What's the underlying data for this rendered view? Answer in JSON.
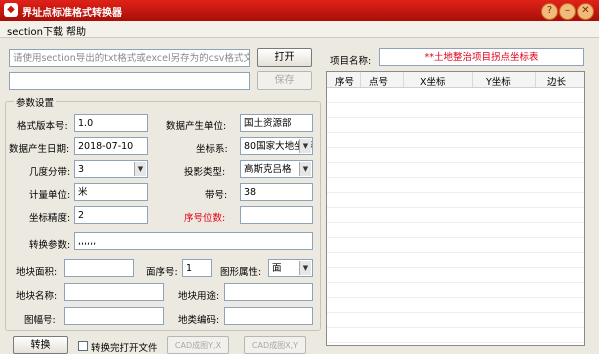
{
  "window": {
    "title": "界址点标准格式转换器",
    "icon_glyph": "◆",
    "buttons": {
      "help": "?",
      "minimize": "–",
      "maximize": "□",
      "close": "✕"
    }
  },
  "menu": {
    "items": [
      "section下载",
      "帮助"
    ]
  },
  "file": {
    "path_placeholder": "请使用section导出的txt格式或excel另存为的csv格式文件",
    "open_label": "打开",
    "save_path_value": "",
    "save_label": "保存"
  },
  "project": {
    "label": "项目名称:",
    "value": "**土地整治项目拐点坐标表"
  },
  "params": {
    "group_title": "参数设置",
    "format_version": {
      "label": "格式版本号:",
      "value": "1.0"
    },
    "data_unit": {
      "label": "数据产生单位:",
      "value": "国土资源部"
    },
    "data_date": {
      "label": "数据产生日期:",
      "value": "2018-07-10"
    },
    "coord_system": {
      "label": "坐标系:",
      "value": "80国家大地坐标系"
    },
    "zone": {
      "label": "几度分带:",
      "value": "3"
    },
    "projection": {
      "label": "投影类型:",
      "value": "高斯克吕格"
    },
    "unit": {
      "label": "计量单位:",
      "value": "米"
    },
    "band": {
      "label": "带号:",
      "value": "38"
    },
    "precision": {
      "label": "坐标精度:",
      "value": "2"
    },
    "serial_digits": {
      "label": "序号位数:",
      "value": ""
    },
    "transform": {
      "label": "转换参数:",
      "value": ",,,,,,"
    }
  },
  "parcel": {
    "area": {
      "label": "地块面积:",
      "value": ""
    },
    "seq": {
      "label": "面序号:",
      "value": "1"
    },
    "shape": {
      "label": "图形属性:",
      "value": "面"
    },
    "name": {
      "label": "地块名称:",
      "value": ""
    },
    "use": {
      "label": "地块用途:",
      "value": ""
    },
    "sheet": {
      "label": "图幅号:",
      "value": ""
    },
    "land_code": {
      "label": "地类编码:",
      "value": ""
    }
  },
  "actions": {
    "convert": "转换",
    "open_after": "转换完打开文件",
    "cad_yx": "CAD成图Y,X",
    "cad_xy": "CAD成图X,Y"
  },
  "table": {
    "columns": [
      "序号",
      "点号",
      "X坐标",
      "Y坐标",
      "边长"
    ],
    "rows": []
  }
}
